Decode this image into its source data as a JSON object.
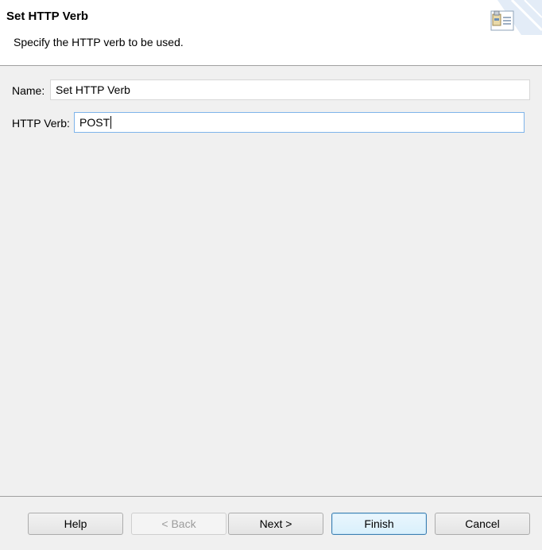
{
  "header": {
    "title": "Set HTTP Verb",
    "description": "Specify the HTTP verb to be used.",
    "icon": "wizard-icon"
  },
  "form": {
    "name_label": "Name:",
    "name_value": "Set HTTP Verb",
    "verb_label": "HTTP Verb:",
    "verb_value": "POST"
  },
  "buttons": {
    "help": "Help",
    "back": "< Back",
    "next": "Next >",
    "finish": "Finish",
    "cancel": "Cancel"
  }
}
